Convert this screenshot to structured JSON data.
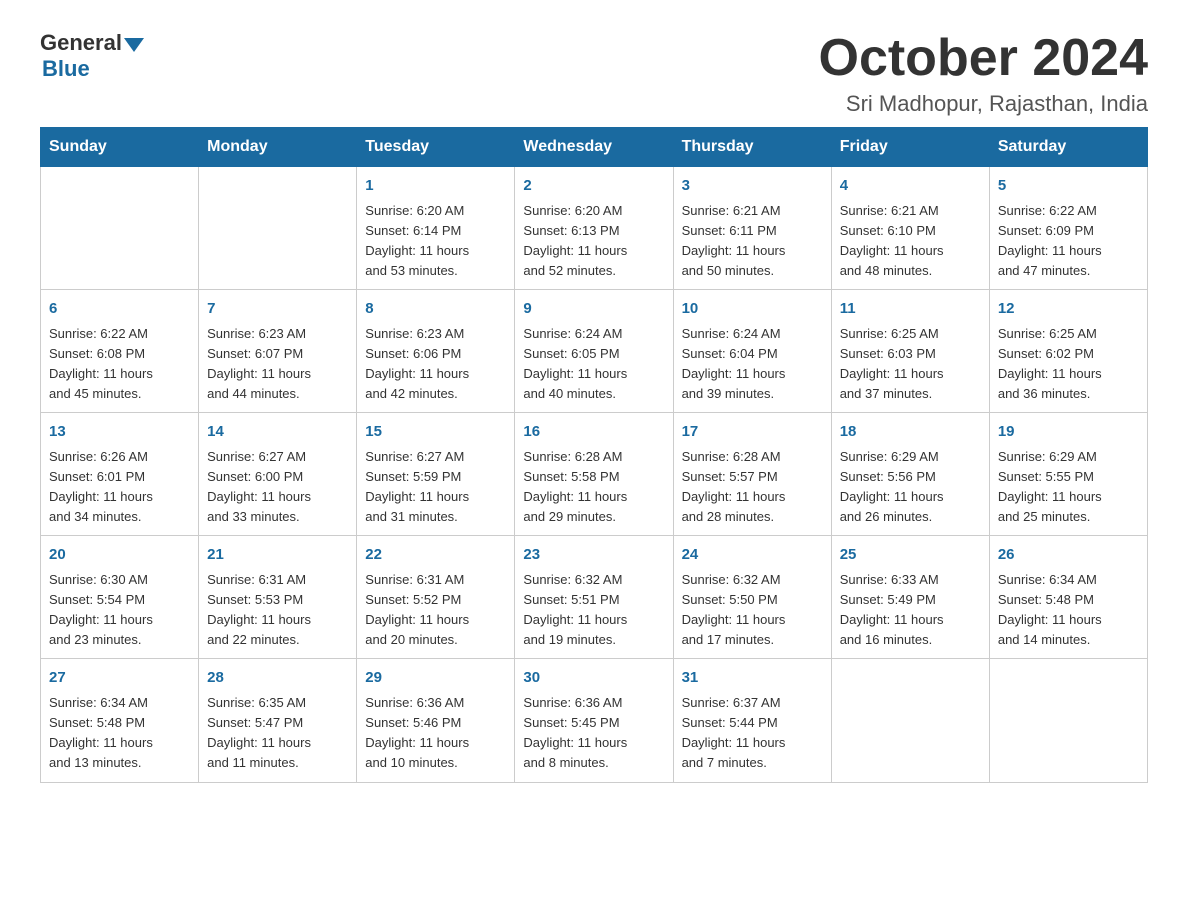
{
  "header": {
    "logo_general": "General",
    "logo_blue": "Blue",
    "title": "October 2024",
    "subtitle": "Sri Madhopur, Rajasthan, India"
  },
  "weekdays": [
    "Sunday",
    "Monday",
    "Tuesday",
    "Wednesday",
    "Thursday",
    "Friday",
    "Saturday"
  ],
  "weeks": [
    [
      {
        "day": "",
        "info": ""
      },
      {
        "day": "",
        "info": ""
      },
      {
        "day": "1",
        "info": "Sunrise: 6:20 AM\nSunset: 6:14 PM\nDaylight: 11 hours\nand 53 minutes."
      },
      {
        "day": "2",
        "info": "Sunrise: 6:20 AM\nSunset: 6:13 PM\nDaylight: 11 hours\nand 52 minutes."
      },
      {
        "day": "3",
        "info": "Sunrise: 6:21 AM\nSunset: 6:11 PM\nDaylight: 11 hours\nand 50 minutes."
      },
      {
        "day": "4",
        "info": "Sunrise: 6:21 AM\nSunset: 6:10 PM\nDaylight: 11 hours\nand 48 minutes."
      },
      {
        "day": "5",
        "info": "Sunrise: 6:22 AM\nSunset: 6:09 PM\nDaylight: 11 hours\nand 47 minutes."
      }
    ],
    [
      {
        "day": "6",
        "info": "Sunrise: 6:22 AM\nSunset: 6:08 PM\nDaylight: 11 hours\nand 45 minutes."
      },
      {
        "day": "7",
        "info": "Sunrise: 6:23 AM\nSunset: 6:07 PM\nDaylight: 11 hours\nand 44 minutes."
      },
      {
        "day": "8",
        "info": "Sunrise: 6:23 AM\nSunset: 6:06 PM\nDaylight: 11 hours\nand 42 minutes."
      },
      {
        "day": "9",
        "info": "Sunrise: 6:24 AM\nSunset: 6:05 PM\nDaylight: 11 hours\nand 40 minutes."
      },
      {
        "day": "10",
        "info": "Sunrise: 6:24 AM\nSunset: 6:04 PM\nDaylight: 11 hours\nand 39 minutes."
      },
      {
        "day": "11",
        "info": "Sunrise: 6:25 AM\nSunset: 6:03 PM\nDaylight: 11 hours\nand 37 minutes."
      },
      {
        "day": "12",
        "info": "Sunrise: 6:25 AM\nSunset: 6:02 PM\nDaylight: 11 hours\nand 36 minutes."
      }
    ],
    [
      {
        "day": "13",
        "info": "Sunrise: 6:26 AM\nSunset: 6:01 PM\nDaylight: 11 hours\nand 34 minutes."
      },
      {
        "day": "14",
        "info": "Sunrise: 6:27 AM\nSunset: 6:00 PM\nDaylight: 11 hours\nand 33 minutes."
      },
      {
        "day": "15",
        "info": "Sunrise: 6:27 AM\nSunset: 5:59 PM\nDaylight: 11 hours\nand 31 minutes."
      },
      {
        "day": "16",
        "info": "Sunrise: 6:28 AM\nSunset: 5:58 PM\nDaylight: 11 hours\nand 29 minutes."
      },
      {
        "day": "17",
        "info": "Sunrise: 6:28 AM\nSunset: 5:57 PM\nDaylight: 11 hours\nand 28 minutes."
      },
      {
        "day": "18",
        "info": "Sunrise: 6:29 AM\nSunset: 5:56 PM\nDaylight: 11 hours\nand 26 minutes."
      },
      {
        "day": "19",
        "info": "Sunrise: 6:29 AM\nSunset: 5:55 PM\nDaylight: 11 hours\nand 25 minutes."
      }
    ],
    [
      {
        "day": "20",
        "info": "Sunrise: 6:30 AM\nSunset: 5:54 PM\nDaylight: 11 hours\nand 23 minutes."
      },
      {
        "day": "21",
        "info": "Sunrise: 6:31 AM\nSunset: 5:53 PM\nDaylight: 11 hours\nand 22 minutes."
      },
      {
        "day": "22",
        "info": "Sunrise: 6:31 AM\nSunset: 5:52 PM\nDaylight: 11 hours\nand 20 minutes."
      },
      {
        "day": "23",
        "info": "Sunrise: 6:32 AM\nSunset: 5:51 PM\nDaylight: 11 hours\nand 19 minutes."
      },
      {
        "day": "24",
        "info": "Sunrise: 6:32 AM\nSunset: 5:50 PM\nDaylight: 11 hours\nand 17 minutes."
      },
      {
        "day": "25",
        "info": "Sunrise: 6:33 AM\nSunset: 5:49 PM\nDaylight: 11 hours\nand 16 minutes."
      },
      {
        "day": "26",
        "info": "Sunrise: 6:34 AM\nSunset: 5:48 PM\nDaylight: 11 hours\nand 14 minutes."
      }
    ],
    [
      {
        "day": "27",
        "info": "Sunrise: 6:34 AM\nSunset: 5:48 PM\nDaylight: 11 hours\nand 13 minutes."
      },
      {
        "day": "28",
        "info": "Sunrise: 6:35 AM\nSunset: 5:47 PM\nDaylight: 11 hours\nand 11 minutes."
      },
      {
        "day": "29",
        "info": "Sunrise: 6:36 AM\nSunset: 5:46 PM\nDaylight: 11 hours\nand 10 minutes."
      },
      {
        "day": "30",
        "info": "Sunrise: 6:36 AM\nSunset: 5:45 PM\nDaylight: 11 hours\nand 8 minutes."
      },
      {
        "day": "31",
        "info": "Sunrise: 6:37 AM\nSunset: 5:44 PM\nDaylight: 11 hours\nand 7 minutes."
      },
      {
        "day": "",
        "info": ""
      },
      {
        "day": "",
        "info": ""
      }
    ]
  ]
}
